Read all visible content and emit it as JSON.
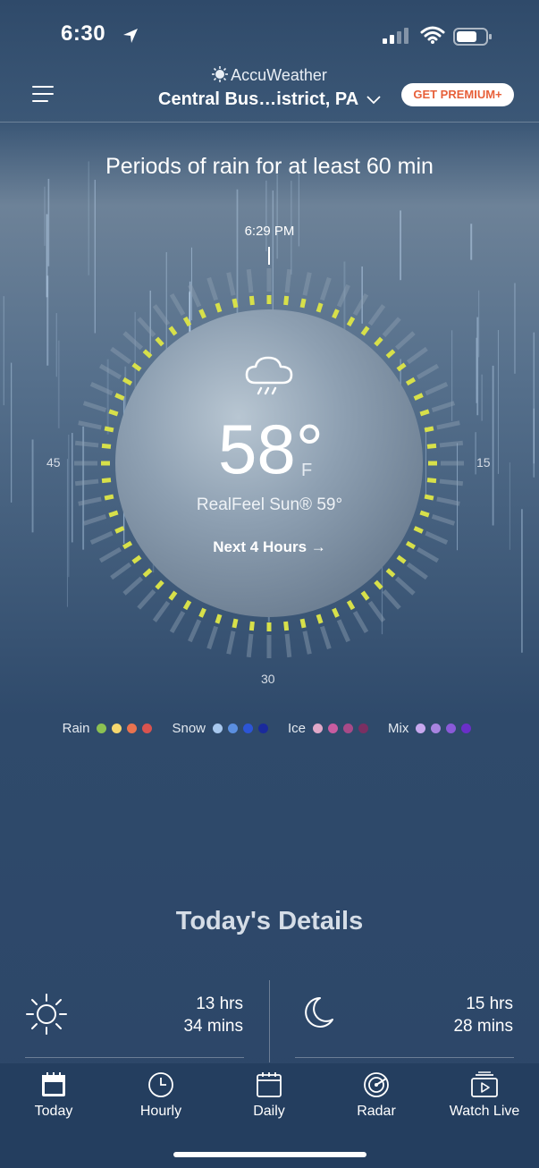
{
  "status_bar": {
    "time": "6:30"
  },
  "header": {
    "brand": "AccuWeather",
    "location": "Central Bus…istrict, PA",
    "premium_label": "GET PREMIUM+"
  },
  "minutecast": {
    "headline": "Periods of rain for at least 60 min",
    "current_time": "6:29 PM",
    "tick_labels": {
      "left": "45",
      "right": "15",
      "bottom": "30"
    },
    "temperature": "58°",
    "unit": "F",
    "realfeel": "RealFeel Sun® 59°",
    "next_link": "Next 4 Hours →",
    "icon": "cloud-rain-icon"
  },
  "legend": [
    {
      "label": "Rain",
      "colors": [
        "#8cc152",
        "#f5d76e",
        "#e9734f",
        "#d9534f"
      ]
    },
    {
      "label": "Snow",
      "colors": [
        "#a8c8ee",
        "#5b8fe0",
        "#2c55d6",
        "#1a2a9c"
      ]
    },
    {
      "label": "Ice",
      "colors": [
        "#e0a8c8",
        "#c85ca0",
        "#a84a88",
        "#7a2f62"
      ]
    },
    {
      "label": "Mix",
      "colors": [
        "#c8a8ee",
        "#a884e0",
        "#8a5ad8",
        "#6a2fc8"
      ]
    }
  ],
  "details": {
    "title": "Today's Details",
    "daylight": {
      "hrs": "13 hrs",
      "mins": "34 mins",
      "icon": "sun-icon"
    },
    "moon": {
      "hrs": "15 hrs",
      "mins": "28 mins",
      "icon": "moon-icon"
    }
  },
  "tabs": [
    {
      "label": "Today",
      "icon": "calendar-today-icon"
    },
    {
      "label": "Hourly",
      "icon": "clock-icon"
    },
    {
      "label": "Daily",
      "icon": "calendar-icon"
    },
    {
      "label": "Radar",
      "icon": "radar-icon"
    },
    {
      "label": "Watch Live",
      "icon": "video-icon"
    }
  ],
  "colors": {
    "accent": "#e7603a",
    "rain_tick": "#d7e04a",
    "dry_tick": "#8e9fb2",
    "tabbar": "#243e5f"
  }
}
